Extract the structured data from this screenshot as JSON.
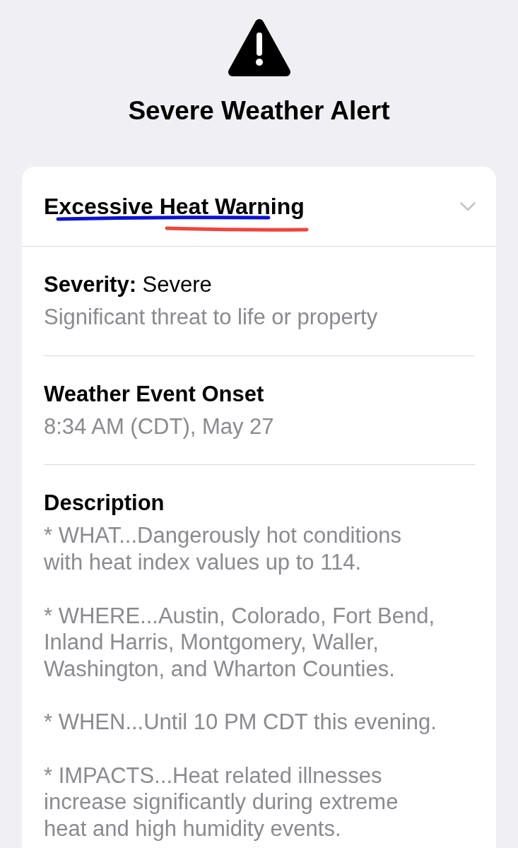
{
  "alert": {
    "title": "Severe Weather Alert"
  },
  "card": {
    "header": {
      "title": "Excessive Heat Warning",
      "annotations": [
        {
          "kind": "underline",
          "color": "#0a12d0"
        },
        {
          "kind": "underline",
          "color": "#f0443a"
        }
      ]
    },
    "sections": [
      {
        "kind": "field",
        "heading": "**Severity:** Severe",
        "paragraphs": [
          [
            "Significant threat to life or property"
          ]
        ]
      },
      {
        "kind": "heading",
        "heading": "Weather Event Onset",
        "paragraphs": [
          [
            "8:34 AM (CDT), May 27"
          ]
        ]
      },
      {
        "kind": "heading",
        "heading": "Description",
        "paragraphs": [
          [
            "* WHAT...Dangerously hot conditions",
            "with heat index values up to 114."
          ],
          [
            "* WHERE...Austin, Colorado, Fort Bend,",
            "Inland Harris, Montgomery, Waller,",
            "Washington, and Wharton Counties."
          ],
          [
            "* WHEN...Until 10 PM CDT this evening."
          ],
          [
            "* IMPACTS...Heat related illnesses",
            "increase significantly during extreme",
            "heat and high humidity events."
          ]
        ]
      }
    ]
  }
}
